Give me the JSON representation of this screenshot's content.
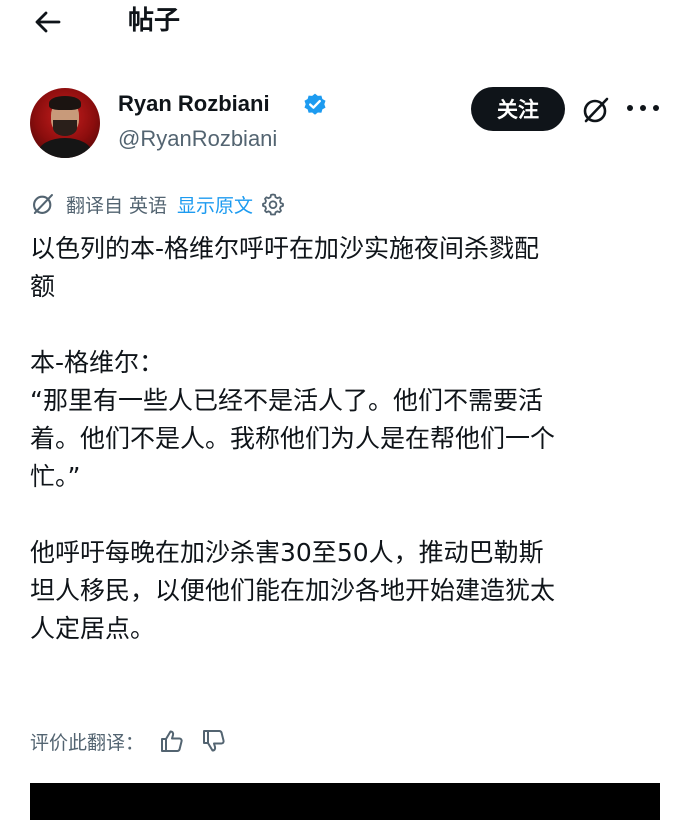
{
  "header": {
    "title": "帖子",
    "back_icon": "arrow-left-icon"
  },
  "author": {
    "name": "Ryan Rozbiani",
    "handle": "@RyanRozbiani",
    "verified": true,
    "verified_color": "#1d9bf0"
  },
  "actions": {
    "follow_label": "关注",
    "grok_icon": "grok-icon",
    "more_icon": "more-icon"
  },
  "translation": {
    "label": "翻译自 英语",
    "show_original": "显示原文",
    "link_color": "#1d9bf0",
    "settings_icon": "gear-icon"
  },
  "post": {
    "paragraphs": [
      "以色列的本-格维尔呼吁在加沙实施夜间杀戮配\n额",
      "本-格维尔：\n“那里有一些人已经不是活人了。他们不需要活\n着。他们不是人。我称他们为人是在帮他们一个\n忙。”",
      "他呼吁每晚在加沙杀害30至50人，推动巴勒斯\n坦人移民，以便他们能在加沙各地开始建造犹太\n人定居点。"
    ]
  },
  "feedback": {
    "label": "评价此翻译：",
    "thumbs_up_icon": "thumbs-up-icon",
    "thumbs_down_icon": "thumbs-down-icon"
  }
}
